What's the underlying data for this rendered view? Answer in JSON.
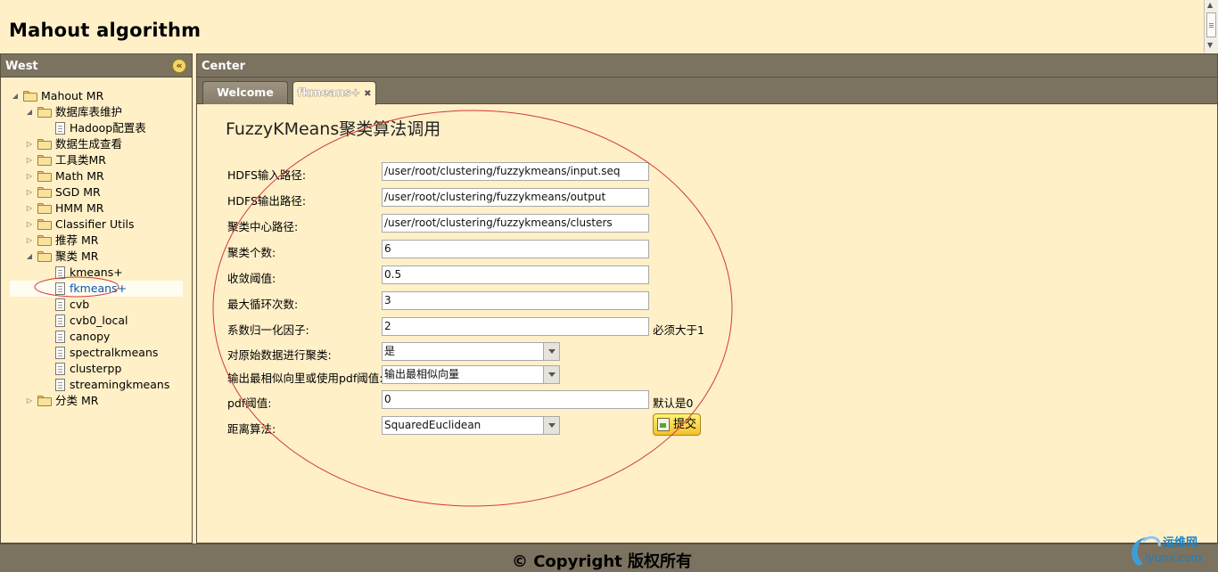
{
  "app": {
    "title": "Mahout algorithm"
  },
  "west": {
    "title": "West",
    "tree": [
      {
        "label": "Mahout MR",
        "type": "folder",
        "level": 0,
        "state": "expanded"
      },
      {
        "label": "数据库表维护",
        "type": "folder",
        "level": 1,
        "state": "expanded"
      },
      {
        "label": "Hadoop配置表",
        "type": "file",
        "level": 2
      },
      {
        "label": "数据生成查看",
        "type": "folder",
        "level": 1,
        "state": "collapsed"
      },
      {
        "label": "工具类MR",
        "type": "folder",
        "level": 1,
        "state": "collapsed"
      },
      {
        "label": "Math MR",
        "type": "folder",
        "level": 1,
        "state": "collapsed"
      },
      {
        "label": "SGD MR",
        "type": "folder",
        "level": 1,
        "state": "collapsed"
      },
      {
        "label": "HMM MR",
        "type": "folder",
        "level": 1,
        "state": "collapsed"
      },
      {
        "label": "Classifier Utils",
        "type": "folder",
        "level": 1,
        "state": "collapsed"
      },
      {
        "label": "推荐 MR",
        "type": "folder",
        "level": 1,
        "state": "collapsed"
      },
      {
        "label": "聚类 MR",
        "type": "folder",
        "level": 1,
        "state": "expanded"
      },
      {
        "label": "kmeans+",
        "type": "file",
        "level": 2
      },
      {
        "label": "fkmeans+",
        "type": "file",
        "level": 2,
        "selected": true
      },
      {
        "label": "cvb",
        "type": "file",
        "level": 2
      },
      {
        "label": "cvb0_local",
        "type": "file",
        "level": 2
      },
      {
        "label": "canopy",
        "type": "file",
        "level": 2
      },
      {
        "label": "spectralkmeans",
        "type": "file",
        "level": 2
      },
      {
        "label": "clusterpp",
        "type": "file",
        "level": 2
      },
      {
        "label": "streamingkmeans",
        "type": "file",
        "level": 2
      },
      {
        "label": "分类 MR",
        "type": "folder",
        "level": 1,
        "state": "collapsed"
      }
    ]
  },
  "center": {
    "title": "Center",
    "tabs": [
      {
        "label": "Welcome",
        "active": false
      },
      {
        "label": "fkmeans+",
        "active": true,
        "closable": true
      }
    ]
  },
  "form": {
    "title": "FuzzyKMeans聚类算法调用",
    "input_path": {
      "label": "HDFS输入路径:",
      "value": "/user/root/clustering/fuzzykmeans/input.seq"
    },
    "output_path": {
      "label": "HDFS输出路径:",
      "value": "/user/root/clustering/fuzzykmeans/output"
    },
    "clusters_path": {
      "label": "聚类中心路径:",
      "value": "/user/root/clustering/fuzzykmeans/clusters"
    },
    "k": {
      "label": "聚类个数:",
      "value": "6"
    },
    "convergence": {
      "label": "收敛阈值:",
      "value": "0.5"
    },
    "max_iter": {
      "label": "最大循环次数:",
      "value": "3"
    },
    "m": {
      "label": "系数归一化因子:",
      "value": "2",
      "hint": "必须大于1"
    },
    "cluster_data": {
      "label": "对原始数据进行聚类:",
      "value": "是"
    },
    "emit_mode": {
      "label": "输出最相似向里或使用pdf阈值:",
      "value": "输出最相似向量"
    },
    "pdf": {
      "label": "pdf阈值:",
      "value": "0",
      "hint": "默认是0"
    },
    "distance": {
      "label": "距离算法:",
      "value": "SquaredEuclidean"
    },
    "submit_label": "提交"
  },
  "footer": {
    "copyright": "© Copyright 版权所有"
  },
  "watermark": {
    "name": "运维网",
    "url": "iyunv.com"
  },
  "colors": {
    "header_bar": "#7c7260",
    "background": "#fff0c8",
    "annotation": "#d23a3a",
    "selected_text": "#0a56b0"
  }
}
